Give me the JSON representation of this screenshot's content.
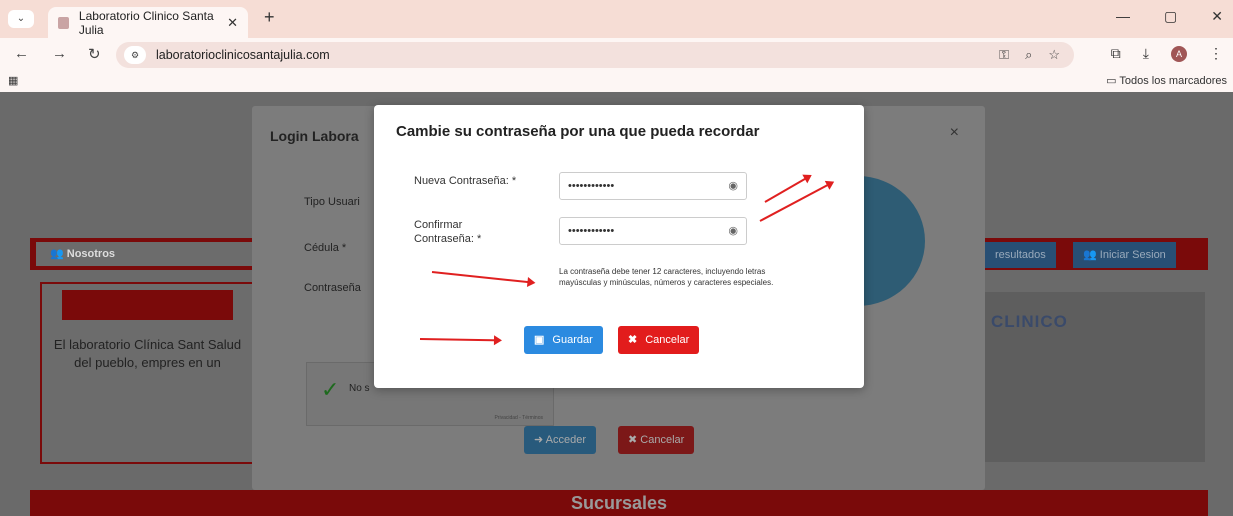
{
  "browser": {
    "tab_title": "Laboratorio Clinico Santa Julia",
    "url": "laboratorioclinicosantajulia.com",
    "bookmarks_label": "Todos los marcadores",
    "avatar_letter": "A"
  },
  "page": {
    "nosotros": "Nosotros",
    "resultados": "resultados",
    "iniciar_sesion": "Iniciar Sesion",
    "about_text": "El laboratorio Clínica Sant Salud del pueblo, empres en un",
    "logo_text": "CLINICO",
    "sucursales": "Sucursales"
  },
  "login_modal": {
    "title": "Login Labora",
    "tipo_usuario": "Tipo Usuari",
    "cedula": "Cédula *",
    "contrasena": "Contraseña",
    "captcha_text": "No s",
    "captcha_privacy": "Privacidad - Términos",
    "acceder": "Acceder",
    "cancelar": "Cancelar",
    "close": "×"
  },
  "password_modal": {
    "title": "Cambie su contraseña por una que pueda recordar",
    "new_label": "Nueva Contraseña: *",
    "new_value": "••••••••••••",
    "confirm_label_1": "Confirmar",
    "confirm_label_2": "Contraseña: *",
    "confirm_value": "••••••••••••",
    "hint_line1": "La contraseña debe tener 12 caracteres, incluyendo letras",
    "hint_line2": "mayúsculas y minúsculas, números y caracteres especiales.",
    "guardar": "Guardar",
    "cancelar": "Cancelar"
  },
  "colors": {
    "primary": "#2b8ae0",
    "danger": "#e21c1c",
    "brand_red": "#7a0a0a"
  }
}
